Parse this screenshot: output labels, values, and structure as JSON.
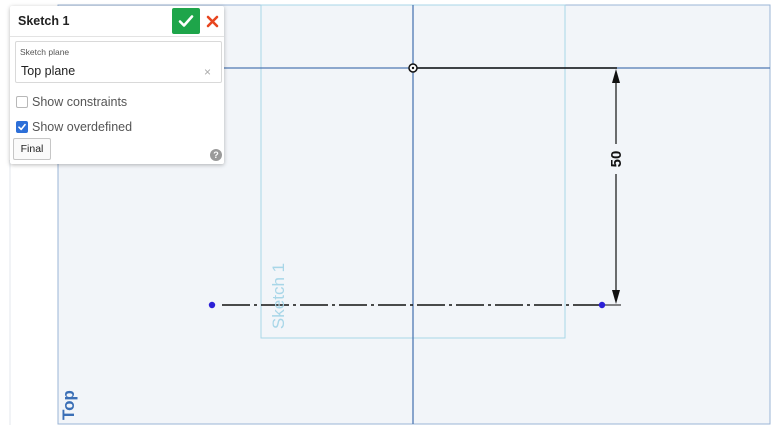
{
  "panel": {
    "title": "Sketch 1",
    "confirm_icon": "check-icon",
    "cancel_icon": "close-icon",
    "sketch_plane": {
      "label": "Sketch plane",
      "value": "Top plane",
      "clear_icon": "clear-icon",
      "clear_glyph": "×"
    },
    "show_constraints": {
      "label": "Show constraints",
      "checked": false
    },
    "show_overdefined": {
      "label": "Show overdefined",
      "checked": true
    },
    "final_label": "Final",
    "help_glyph": "?",
    "help_icon": "help-icon"
  },
  "canvas": {
    "plane_label": "Top",
    "sketch_label": "Sketch 1",
    "dimension_value": "50",
    "colors": {
      "background": "#f2f5f9",
      "plane_border": "#9bb5d6",
      "axis": "#4f79b3",
      "sketch_region": "#a8d6e8",
      "sketch_label": "#a8d6e8",
      "plane_label": "#3b6fb6",
      "geometry": "#111111",
      "endpoint": "#2b1fd6",
      "confirm": "#1ea54a",
      "cancel": "#e8451f",
      "checkbox_checked": "#2d6fd8"
    }
  }
}
